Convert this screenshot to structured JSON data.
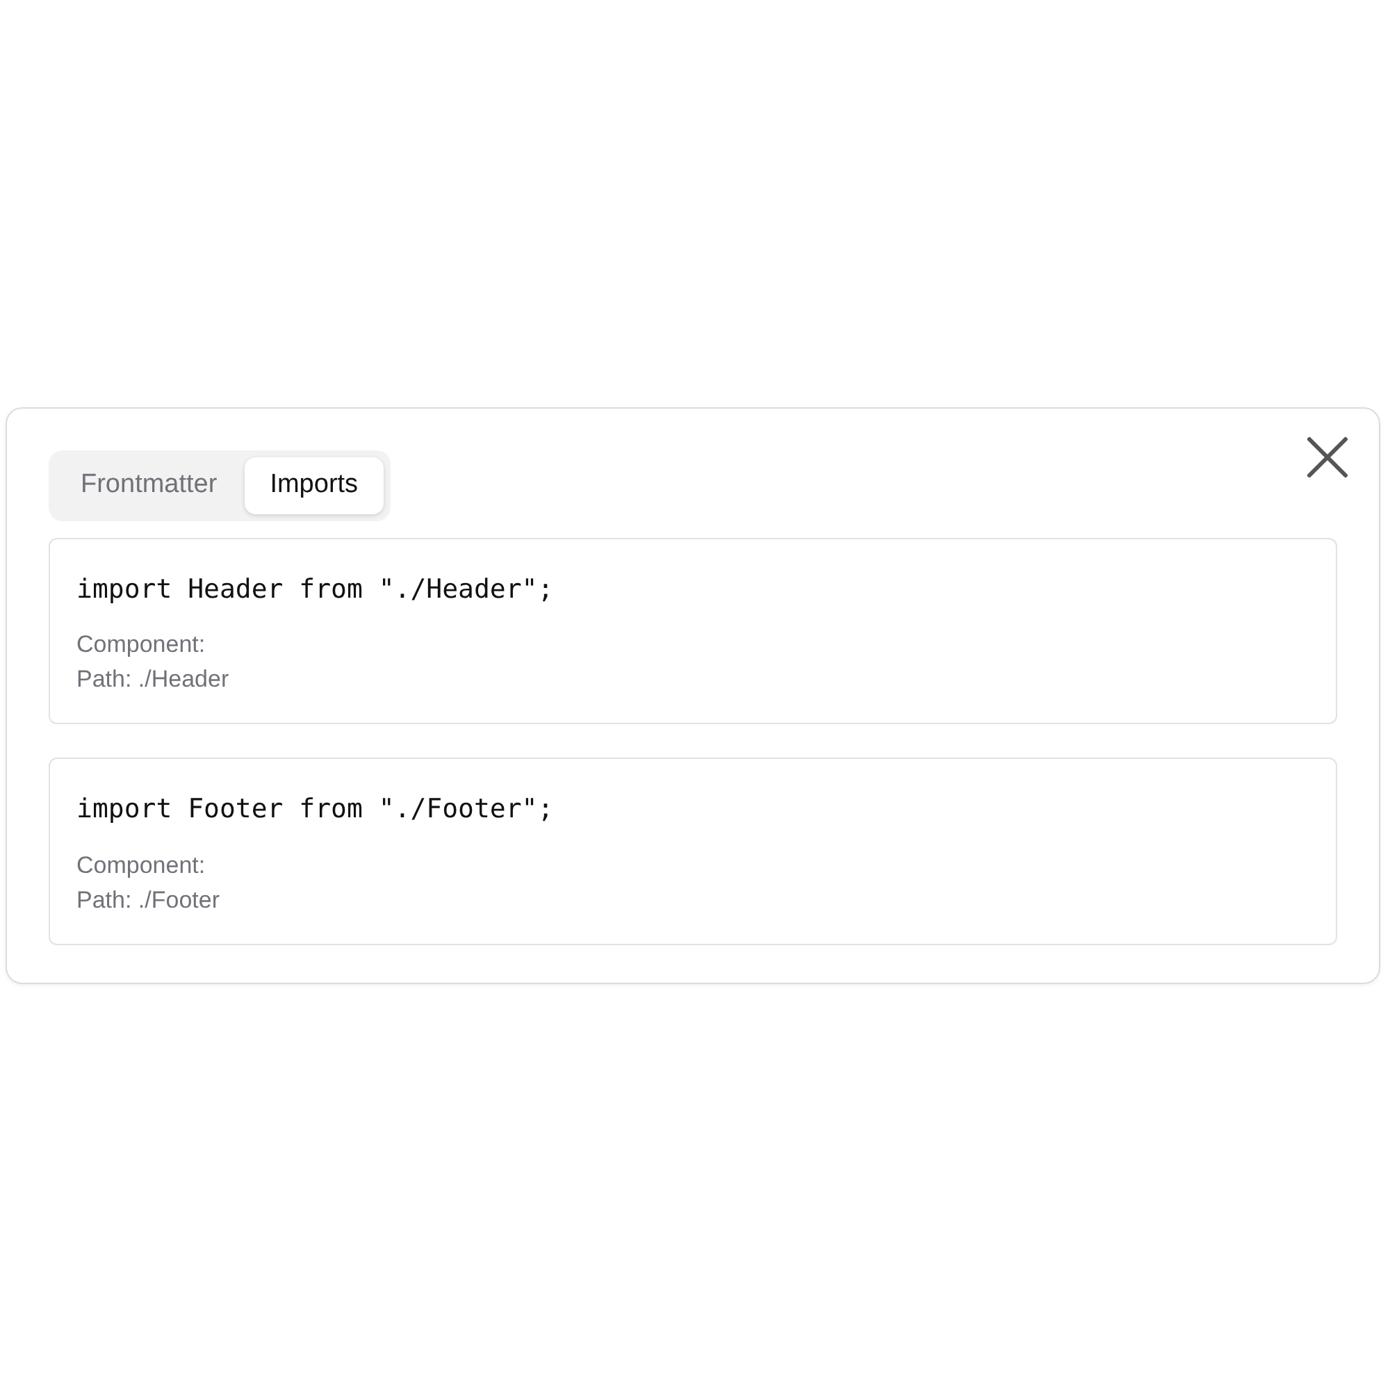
{
  "tabs": [
    {
      "label": "Frontmatter",
      "selected": false
    },
    {
      "label": "Imports",
      "selected": true
    }
  ],
  "imports": [
    {
      "code": "import Header from \"./Header\";",
      "component": "Component:",
      "path": "Path: ./Header"
    },
    {
      "code": "import Footer from \"./Footer\";",
      "component": "Component:",
      "path": "Path: ./Footer"
    }
  ]
}
